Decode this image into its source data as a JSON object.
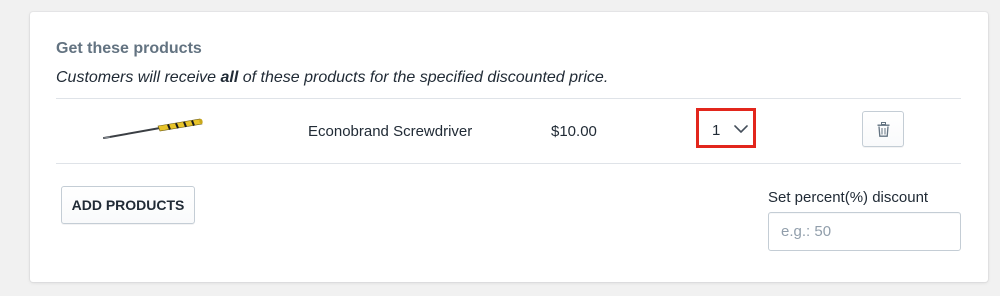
{
  "section": {
    "heading": "Get these products",
    "subtext_before": "Customers will receive ",
    "subtext_bold": "all",
    "subtext_after": " of these products for the specified discounted price."
  },
  "products": [
    {
      "name": "Econobrand Screwdriver",
      "price": "$10.00",
      "quantity": "1",
      "thumbnail_icon": "screwdriver-image"
    }
  ],
  "actions": {
    "add_products_label": "ADD PRODUCTS",
    "delete_icon": "trash-icon"
  },
  "discount": {
    "label": "Set percent(%) discount",
    "value": "",
    "placeholder": "e.g.: 50"
  },
  "colors": {
    "highlight_border": "#e2261c",
    "screwdriver_handle": "#e8c42a",
    "screwdriver_handle_stripes": "#1a1a1a",
    "screwdriver_shaft": "#3b3f44"
  }
}
